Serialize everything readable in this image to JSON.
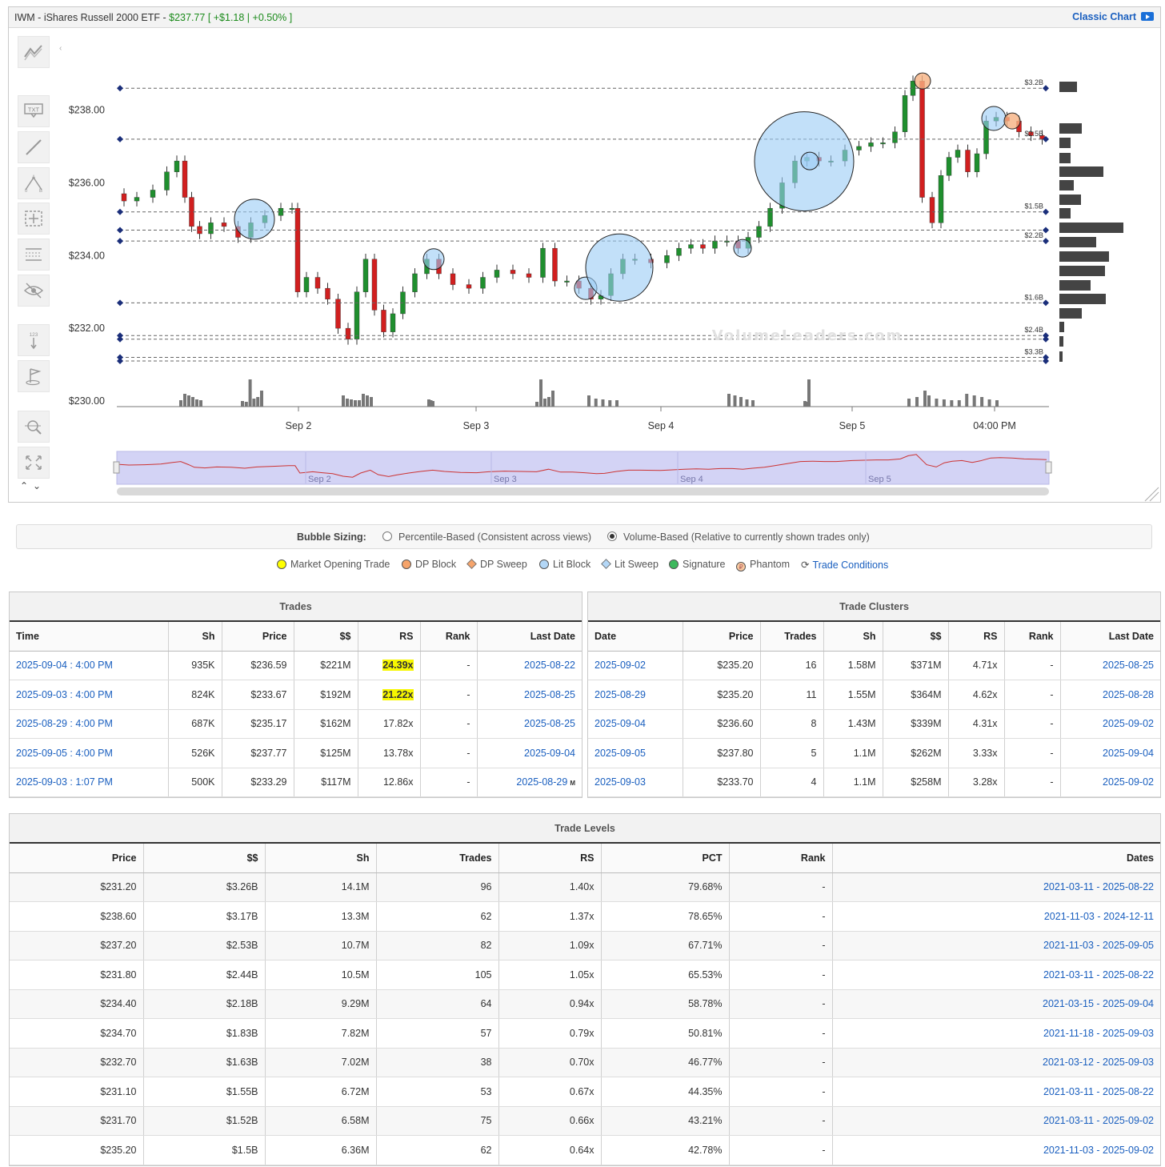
{
  "header": {
    "ticker": "IWM",
    "name": "iShares Russell 2000 ETF",
    "price": "$237.77",
    "change": "[ +$1.18 | +0.50% ]",
    "classic_chart": "Classic Chart"
  },
  "toolbar_icons": [
    "trend-lines-icon",
    "text-icon",
    "line-icon",
    "fibonacci-icon",
    "measure-icon",
    "levels-icon",
    "hide-icon",
    "counter-icon",
    "flag-icon",
    "zoom-icon",
    "fullscreen-icon"
  ],
  "chart_data": {
    "type": "candlestick",
    "y_ticks": [
      "$238.00",
      "$236.00",
      "$234.00",
      "$232.00",
      "$230.00"
    ],
    "x_ticks": [
      "Sep 2",
      "Sep 3",
      "Sep 4",
      "Sep 5",
      "04:00 PM"
    ],
    "ylim": [
      229.5,
      239.5
    ],
    "watermark": "VolumeLeaders.com",
    "price_levels": [
      {
        "price": 238.6,
        "label": "$3.2B"
      },
      {
        "price": 237.2,
        "label": "$2.5B"
      },
      {
        "price": 235.2,
        "label": "$1.5B"
      },
      {
        "price": 234.7,
        "label": ""
      },
      {
        "price": 234.4,
        "label": "$2.2B"
      },
      {
        "price": 232.7,
        "label": "$1.6B"
      },
      {
        "price": 231.8,
        "label": "$2.4B"
      },
      {
        "price": 231.7,
        "label": ""
      },
      {
        "price": 231.2,
        "label": "$3.3B"
      },
      {
        "price": 231.1,
        "label": ""
      }
    ],
    "bubbles": [
      {
        "type": "Lit Block",
        "x": "Sep 2 pre",
        "price": 235.0,
        "size": "medium"
      },
      {
        "type": "Lit Block",
        "x": "Sep 2 mid",
        "price": 233.9,
        "size": "small"
      },
      {
        "type": "Lit Block",
        "x": "Sep 3 late",
        "price": 233.1,
        "size": "small"
      },
      {
        "type": "Lit Block",
        "x": "Sep 3 4:00 PM",
        "price": 233.67,
        "size": "large"
      },
      {
        "type": "Lit Block",
        "x": "Sep 4 mid",
        "price": 234.2,
        "size": "small"
      },
      {
        "type": "Lit Block",
        "x": "Sep 4 4:00 PM",
        "price": 236.59,
        "size": "largest"
      },
      {
        "type": "Lit Block",
        "x": "Sep 4 late",
        "price": 236.6,
        "size": "small"
      },
      {
        "type": "Phantom",
        "x": "Sep 5 open",
        "price": 238.8,
        "size": "small"
      },
      {
        "type": "Lit Block",
        "x": "Sep 5 4:00 PM",
        "price": 237.77,
        "size": "small"
      },
      {
        "type": "Phantom",
        "x": "Sep 5 close",
        "price": 237.7,
        "size": "small"
      }
    ]
  },
  "bubble_sizing": {
    "label": "Bubble Sizing:",
    "opt1": "Percentile-Based (Consistent across views)",
    "opt2": "Volume-Based (Relative to currently shown trades only)"
  },
  "legend": {
    "market_opening": "Market Opening Trade",
    "dp_block": "DP Block",
    "dp_sweep": "DP Sweep",
    "lit_block": "Lit Block",
    "lit_sweep": "Lit Sweep",
    "signature": "Signature",
    "phantom": "Phantom",
    "trade_conditions": "Trade Conditions"
  },
  "trades": {
    "title": "Trades",
    "headers": [
      "Time",
      "Sh",
      "Price",
      "$$",
      "RS",
      "Rank",
      "Last Date"
    ],
    "rows": [
      [
        "2025-09-04 : 4:00 PM",
        "935K",
        "$236.59",
        "$221M",
        "24.39x",
        "-",
        "2025-08-22"
      ],
      [
        "2025-09-03 : 4:00 PM",
        "824K",
        "$233.67",
        "$192M",
        "21.22x",
        "-",
        "2025-08-25"
      ],
      [
        "2025-08-29 : 4:00 PM",
        "687K",
        "$235.17",
        "$162M",
        "17.82x",
        "-",
        "2025-08-25"
      ],
      [
        "2025-09-05 : 4:00 PM",
        "526K",
        "$237.77",
        "$125M",
        "13.78x",
        "-",
        "2025-09-04"
      ],
      [
        "2025-09-03 : 1:07 PM",
        "500K",
        "$233.29",
        "$117M",
        "12.86x",
        "-",
        "2025-08-29"
      ]
    ],
    "last_row_tag": "M"
  },
  "clusters": {
    "title": "Trade Clusters",
    "headers": [
      "Date",
      "Price",
      "Trades",
      "Sh",
      "$$",
      "RS",
      "Rank",
      "Last Date"
    ],
    "rows": [
      [
        "2025-09-02",
        "$235.20",
        "16",
        "1.58M",
        "$371M",
        "4.71x",
        "-",
        "2025-08-25"
      ],
      [
        "2025-08-29",
        "$235.20",
        "11",
        "1.55M",
        "$364M",
        "4.62x",
        "-",
        "2025-08-28"
      ],
      [
        "2025-09-04",
        "$236.60",
        "8",
        "1.43M",
        "$339M",
        "4.31x",
        "-",
        "2025-09-02"
      ],
      [
        "2025-09-05",
        "$237.80",
        "5",
        "1.1M",
        "$262M",
        "3.33x",
        "-",
        "2025-09-04"
      ],
      [
        "2025-09-03",
        "$233.70",
        "4",
        "1.1M",
        "$258M",
        "3.28x",
        "-",
        "2025-09-02"
      ]
    ]
  },
  "levels": {
    "title": "Trade Levels",
    "headers": [
      "Price",
      "$$",
      "Sh",
      "Trades",
      "RS",
      "PCT",
      "Rank",
      "Dates"
    ],
    "rows": [
      [
        "$231.20",
        "$3.26B",
        "14.1M",
        "96",
        "1.40x",
        "79.68%",
        "-",
        "2021-03-11 - 2025-08-22"
      ],
      [
        "$238.60",
        "$3.17B",
        "13.3M",
        "62",
        "1.37x",
        "78.65%",
        "-",
        "2021-11-03 - 2024-12-11"
      ],
      [
        "$237.20",
        "$2.53B",
        "10.7M",
        "82",
        "1.09x",
        "67.71%",
        "-",
        "2021-11-03 - 2025-09-05"
      ],
      [
        "$231.80",
        "$2.44B",
        "10.5M",
        "105",
        "1.05x",
        "65.53%",
        "-",
        "2021-03-11 - 2025-08-22"
      ],
      [
        "$234.40",
        "$2.18B",
        "9.29M",
        "64",
        "0.94x",
        "58.78%",
        "-",
        "2021-03-15 - 2025-09-04"
      ],
      [
        "$234.70",
        "$1.83B",
        "7.82M",
        "57",
        "0.79x",
        "50.81%",
        "-",
        "2021-11-18 - 2025-09-03"
      ],
      [
        "$232.70",
        "$1.63B",
        "7.02M",
        "38",
        "0.70x",
        "46.77%",
        "-",
        "2021-03-12 - 2025-09-03"
      ],
      [
        "$231.10",
        "$1.55B",
        "6.72M",
        "53",
        "0.67x",
        "44.35%",
        "-",
        "2021-03-11 - 2025-08-22"
      ],
      [
        "$231.70",
        "$1.52B",
        "6.58M",
        "75",
        "0.66x",
        "43.21%",
        "-",
        "2021-03-11 - 2025-09-02"
      ],
      [
        "$235.20",
        "$1.5B",
        "6.36M",
        "62",
        "0.64x",
        "42.78%",
        "-",
        "2021-11-03 - 2025-09-02"
      ]
    ]
  }
}
